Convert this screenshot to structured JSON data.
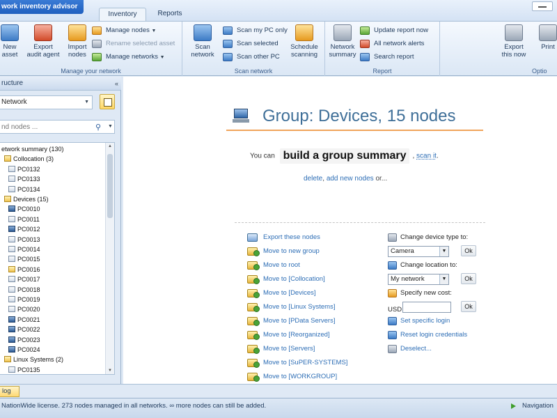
{
  "app": {
    "title": "work inventory advisor"
  },
  "tabs": [
    {
      "label": "Inventory"
    },
    {
      "label": "Reports"
    }
  ],
  "ribbon": {
    "manage": {
      "label": "Manage your network",
      "new_asset": "New\nasset",
      "export_agent": "Export\naudit agent",
      "import_nodes": "Import\nnodes",
      "manage_nodes": "Manage nodes",
      "rename_asset": "Rename selected asset",
      "manage_networks": "Manage networks"
    },
    "scan": {
      "label": "Scan network",
      "scan_network": "Scan\nnetwork",
      "scan_my_pc": "Scan my PC only",
      "scan_selected": "Scan selected",
      "scan_other_pc": "Scan other PC",
      "schedule": "Schedule\nscanning"
    },
    "report": {
      "label": "Report",
      "network_summary": "Network\nsummary",
      "update_report": "Update report now",
      "all_alerts": "All network alerts",
      "search_report": "Search report"
    },
    "options": {
      "label": "Optio",
      "export_now": "Export\nthis now",
      "print": "Print"
    }
  },
  "sidebar": {
    "header": "ructure",
    "network_select": "Network",
    "find_placeholder": "nd nodes ...",
    "tree": [
      {
        "label": "etwork summary (130)",
        "kind": "root"
      },
      {
        "label": "Collocation (3)",
        "kind": "folder"
      },
      {
        "label": "PC0132",
        "kind": "pc"
      },
      {
        "label": "PC0133",
        "kind": "pc"
      },
      {
        "label": "PC0134",
        "kind": "pc"
      },
      {
        "label": "Devices (15)",
        "kind": "folder"
      },
      {
        "label": "PC0010",
        "kind": "mon"
      },
      {
        "label": "PC0011",
        "kind": "pc"
      },
      {
        "label": "PC0012",
        "kind": "mon"
      },
      {
        "label": "PC0013",
        "kind": "pc"
      },
      {
        "label": "PC0014",
        "kind": "pc"
      },
      {
        "label": "PC0015",
        "kind": "pc"
      },
      {
        "label": "PC0016",
        "kind": "folder"
      },
      {
        "label": "PC0017",
        "kind": "pc"
      },
      {
        "label": "PC0018",
        "kind": "pc"
      },
      {
        "label": "PC0019",
        "kind": "pc"
      },
      {
        "label": "PC0020",
        "kind": "pc"
      },
      {
        "label": "PC0021",
        "kind": "mon"
      },
      {
        "label": "PC0022",
        "kind": "mon"
      },
      {
        "label": "PC0023",
        "kind": "mon"
      },
      {
        "label": "PC0024",
        "kind": "mon"
      },
      {
        "label": "Linux Systems (2)",
        "kind": "folder"
      },
      {
        "label": "PC0135",
        "kind": "pc"
      }
    ]
  },
  "main": {
    "title": "Group: Devices, 15 nodes",
    "you_can": "You can",
    "summary_btn": "build a group summary",
    "comma": ",",
    "scan_it": "scan it",
    "period": ".",
    "delete": "delete",
    "add_new_nodes": "add new nodes",
    "or": "or...",
    "actions": [
      "Export these nodes",
      "Move to new group",
      "Move to root",
      "Move to [Collocation]",
      "Move to [Devices]",
      "Move to [Linux Systems]",
      "Move to [PData Servers]",
      "Move to [Reorganized]",
      "Move to [Servers]",
      "Move to [SuPER-SYSTEMS]",
      "Move to [WORKGROUP]"
    ],
    "change_type_label": "Change device type to:",
    "device_type": "Camera",
    "change_location_label": "Change location to:",
    "location": "My network",
    "specify_cost_label": "Specify new cost:",
    "currency": "USD",
    "ok": "Ok",
    "set_login": "Set specific login",
    "reset_login": "Reset login credentials",
    "deselect": "Deselect..."
  },
  "log_tab": "log",
  "status": {
    "text": "NationWide license. 273 nodes managed in all networks. ∞ more nodes can still be added.",
    "nav": "Navigation"
  }
}
